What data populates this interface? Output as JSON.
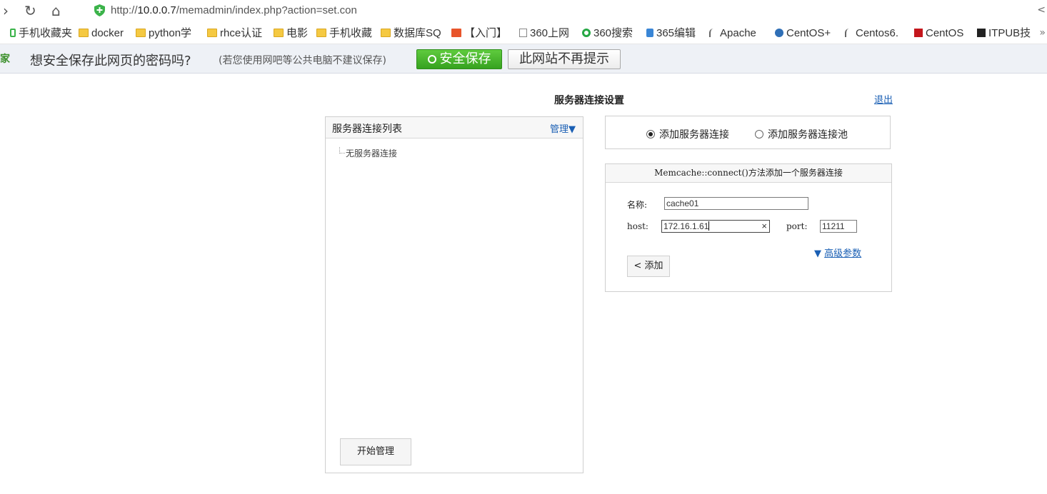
{
  "browser": {
    "url_prefix": "http://",
    "url_host": "10.0.0.7",
    "url_path": "/memadmin/index.php?action=set.con",
    "back_glyph": "›",
    "reload_glyph": "↻",
    "home_glyph": "⌂",
    "share_glyph": "<"
  },
  "bookmarks": [
    {
      "label": "手机收藏夹",
      "icon": "phone-icon"
    },
    {
      "label": "docker",
      "icon": "folder-icon"
    },
    {
      "label": "python学",
      "icon": "folder-icon"
    },
    {
      "label": "rhce认证",
      "icon": "folder-icon"
    },
    {
      "label": "电影",
      "icon": "folder-icon"
    },
    {
      "label": "手机收藏",
      "icon": "folder-icon"
    },
    {
      "label": "数据库SQ",
      "icon": "folder-icon"
    },
    {
      "label": "【入门】",
      "icon": "site-icon"
    },
    {
      "label": "360上网",
      "icon": "page-icon"
    },
    {
      "label": "360搜索",
      "icon": "search-site-icon"
    },
    {
      "label": "365编辑",
      "icon": "site-icon"
    },
    {
      "label": "Apache",
      "icon": "feather-icon"
    },
    {
      "label": "CentOS+",
      "icon": "site-icon"
    },
    {
      "label": "Centos6.",
      "icon": "feather-icon"
    },
    {
      "label": "CentOS",
      "icon": "site-icon"
    },
    {
      "label": "ITPUB技",
      "icon": "site-icon"
    }
  ],
  "bookmarks_more": "»",
  "password_bar": {
    "left_fragment": "管家",
    "question": "想安全保存此网页的密码吗?",
    "hint": "(若您使用网吧等公共电脑不建议保存)",
    "save_label": "安全保存",
    "never_label": "此网站不再提示"
  },
  "page": {
    "title": "服务器连接设置",
    "logout": "退出"
  },
  "server_list": {
    "title": "服务器连接列表",
    "manage": "管理▼",
    "empty_text": "无服务器连接",
    "start_button": "开始管理"
  },
  "connect_mode": {
    "options": [
      {
        "label": "添加服务器连接",
        "selected": true
      },
      {
        "label": "添加服务器连接池",
        "selected": false
      }
    ]
  },
  "form": {
    "header": "Memcache::connect()方法添加一个服务器连接",
    "name_label": "名称:",
    "name_value": "cache01",
    "host_label": "host:",
    "host_value": "172.16.1.61",
    "port_label": "port:",
    "port_value": "11211",
    "advanced_arrow": "▼",
    "advanced_label": "高级参数",
    "add_button": "< 添加",
    "clear_glyph": "×"
  }
}
